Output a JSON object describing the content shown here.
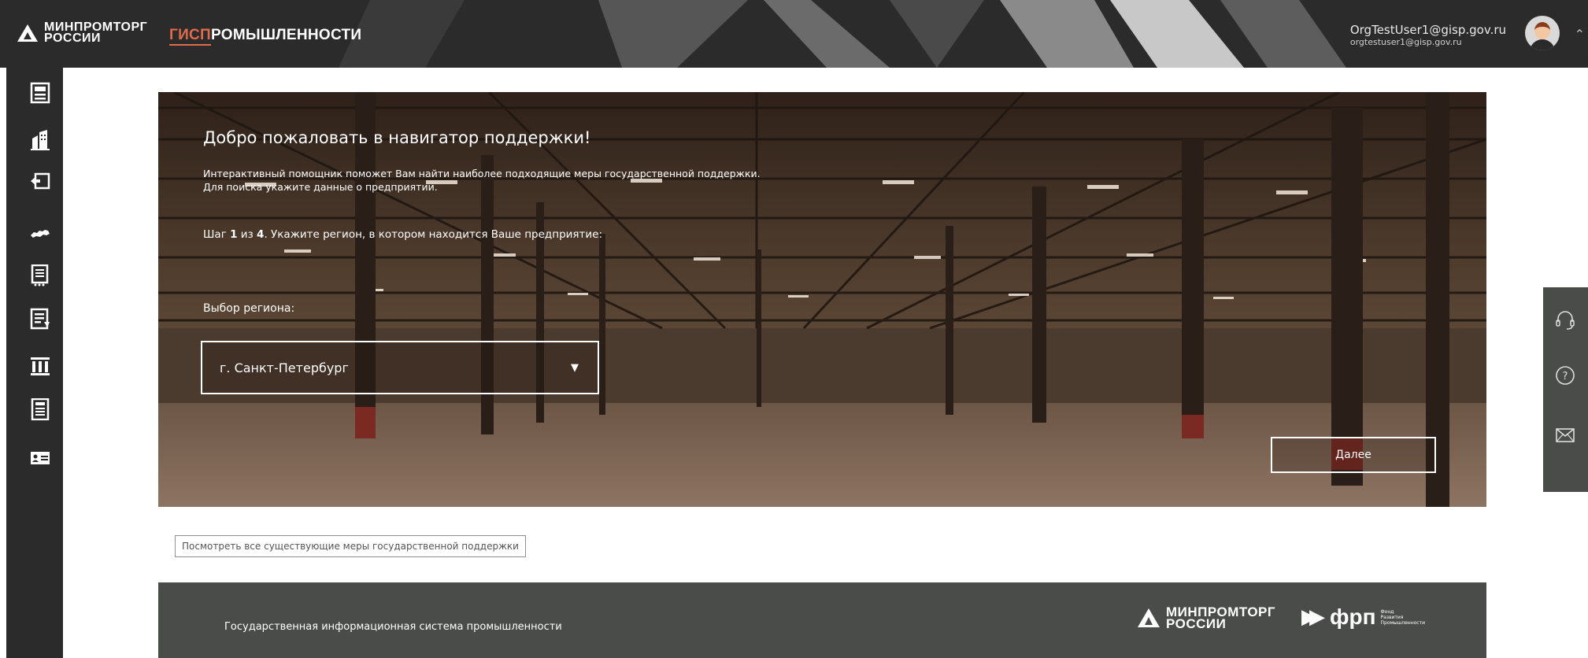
{
  "header": {
    "ministry_logo_text": "МИНПРОМТОРГ\nРОССИИ",
    "gisp_logo_accent": "ГИСП",
    "gisp_logo_rest": "РОМЫШЛЕННОСТИ",
    "user_name": "OrgTestUser1@gisp.gov.ru",
    "user_email": "orgtestuser1@gisp.gov.ru"
  },
  "sidebar": {
    "items": [
      {
        "icon": "registry-icon"
      },
      {
        "icon": "buildings-icon"
      },
      {
        "icon": "import-substitution-icon"
      },
      {
        "icon": "russia-map-icon"
      },
      {
        "icon": "document-list-icon"
      },
      {
        "icon": "report-icon"
      },
      {
        "icon": "catalog-icon"
      },
      {
        "icon": "calculator-icon"
      },
      {
        "icon": "profile-card-icon"
      }
    ]
  },
  "hero": {
    "title": "Добро пожаловать в навигатор поддержки!",
    "desc_line1": "Интерактивный помощник поможет Вам найти наиболее подходящие меры государственной поддержки.",
    "desc_line2": "Для поиска укажите данные о предприятии.",
    "step_prefix": "Шаг ",
    "step_current": "1",
    "step_of": " из ",
    "step_total": "4",
    "step_text": ". Укажите регион, в котором находится Ваше предприятие:",
    "region_label": "Выбор региона:",
    "region_value": "г. Санкт-Петербург",
    "next_label": "Далее"
  },
  "all_measures_link": "Посмотреть все существующие меры государственной поддержки",
  "footer": {
    "text": "Государственная информационная система промышленности",
    "ministry_logo_text": "МИНПРОМТОРГ\nРОССИИ",
    "frp_abbr": "фрп",
    "frp_full": "Фонд Развития Промышленности"
  },
  "right_panel": {
    "items": [
      {
        "icon": "support-headset-icon"
      },
      {
        "icon": "help-question-icon"
      },
      {
        "icon": "mail-envelope-icon"
      }
    ]
  },
  "colors": {
    "topbar": "#2b2b2b",
    "accent": "#e06a4a",
    "footer": "#4a4c4a"
  }
}
